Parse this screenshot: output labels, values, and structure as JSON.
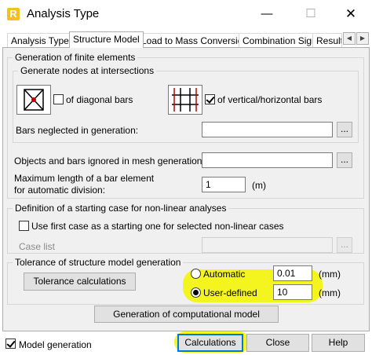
{
  "window": {
    "title": "Analysis Type",
    "app_icon_letter": "R",
    "minimize_glyph": "—",
    "maximize_glyph": "☐",
    "close_glyph": "✕"
  },
  "tabs": [
    {
      "label": "Analysis Types"
    },
    {
      "label": "Structure Model"
    },
    {
      "label": "Load to Mass Conversion"
    },
    {
      "label": "Combination Sign"
    },
    {
      "label": "Result"
    }
  ],
  "tab_scroll": {
    "left_glyph": "◀",
    "right_glyph": "▶"
  },
  "generation": {
    "title": "Generation of finite elements",
    "nodes_group_title": "Generate nodes at intersections",
    "diagonal": {
      "label": "of diagonal bars",
      "checked": false
    },
    "vertical_horizontal": {
      "label": "of vertical/horizontal bars",
      "checked": true
    },
    "bars_neglected_label": "Bars neglected in generation:",
    "bars_neglected_value": "",
    "browse": "..."
  },
  "mesh": {
    "objects_ignored_label": "Objects and bars ignored in mesh generation:",
    "objects_ignored_value": "",
    "browse": "...",
    "max_length_label_1": "Maximum length of a bar element",
    "max_length_label_2": "for automatic division:",
    "max_length_value": "1",
    "max_length_unit": "(m)"
  },
  "nonlinear": {
    "title": "Definition of a starting case for non-linear analyses",
    "use_first_label": "Use first case as a starting one for selected non-linear cases",
    "use_first_checked": false,
    "case_list_label": "Case list",
    "case_list_value": "",
    "browse": "..."
  },
  "tolerance": {
    "title": "Tolerance of structure model generation",
    "calc_button": "Tolerance calculations",
    "automatic_label": "Automatic",
    "automatic_value": "0.01",
    "automatic_unit": "(mm)",
    "user_defined_label": "User-defined",
    "user_defined_value": "10",
    "user_defined_unit": "(mm)",
    "selected": "user_defined"
  },
  "generation_button": "Generation of computational model",
  "footer": {
    "model_generation_label": "Model generation",
    "model_generation_checked": true,
    "calculations_button": "Calculations",
    "close_button": "Close",
    "help_button": "Help"
  },
  "colors": {
    "highlight": "#f4f400",
    "focus": "#0078d7",
    "dialog_bg": "#f0f0f0",
    "grid_red": "#c00000"
  }
}
